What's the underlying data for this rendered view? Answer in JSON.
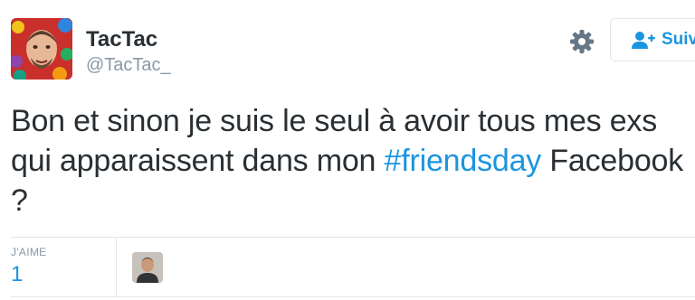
{
  "tweet": {
    "author_name": "TacTac",
    "author_handle": "@TacTac_",
    "text_before": "Bon et sinon je suis le seul à avoir tous mes exs qui apparaissent dans mon ",
    "hashtag": "#friendsday",
    "text_after": " Facebook ?"
  },
  "actions": {
    "follow_label": "Suivre",
    "settings_icon": "gear-icon",
    "follow_icon": "person-plus-icon"
  },
  "stats": {
    "likes_label": "J'AIME",
    "likes_count": "1"
  },
  "colors": {
    "accent": "#1b95e0",
    "text": "#292f33",
    "muted": "#8899a6",
    "border": "#e1e8ed"
  }
}
